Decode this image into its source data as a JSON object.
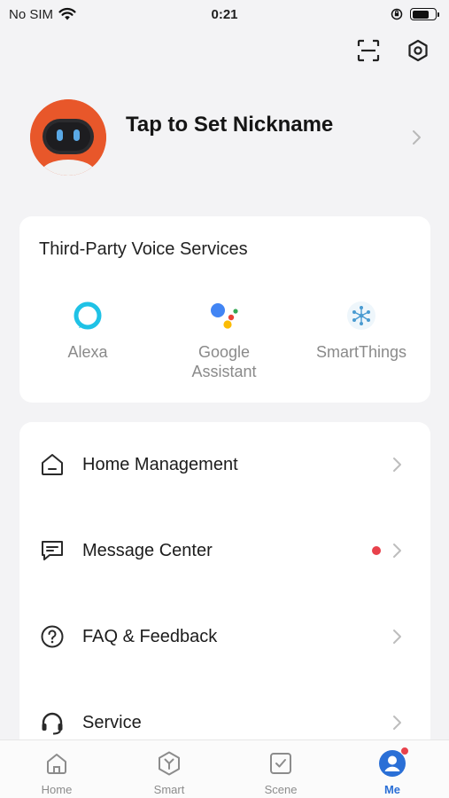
{
  "status_bar": {
    "carrier": "No SIM",
    "time": "0:21"
  },
  "profile": {
    "nickname": "Tap to Set Nickname"
  },
  "voice_services": {
    "title": "Third-Party Voice Services",
    "items": [
      {
        "label": "Alexa",
        "icon": "alexa-icon"
      },
      {
        "label": "Google\nAssistant",
        "icon": "google-assistant-icon"
      },
      {
        "label": "SmartThings",
        "icon": "smartthings-icon"
      }
    ]
  },
  "menu": {
    "items": [
      {
        "label": "Home Management",
        "icon": "home-outline-icon",
        "badge": false
      },
      {
        "label": "Message Center",
        "icon": "message-icon",
        "badge": true
      },
      {
        "label": "FAQ & Feedback",
        "icon": "question-icon",
        "badge": false
      },
      {
        "label": "Service",
        "icon": "headset-icon",
        "badge": false
      }
    ]
  },
  "tabs": [
    {
      "label": "Home",
      "icon": "home-icon",
      "active": false
    },
    {
      "label": "Smart",
      "icon": "smart-icon",
      "active": false
    },
    {
      "label": "Scene",
      "icon": "scene-icon",
      "active": false
    },
    {
      "label": "Me",
      "icon": "me-icon",
      "active": true
    }
  ],
  "colors": {
    "accent": "#2a6fd6",
    "badge": "#e8414b",
    "avatar": "#e8572a",
    "background": "#f3f3f5"
  }
}
